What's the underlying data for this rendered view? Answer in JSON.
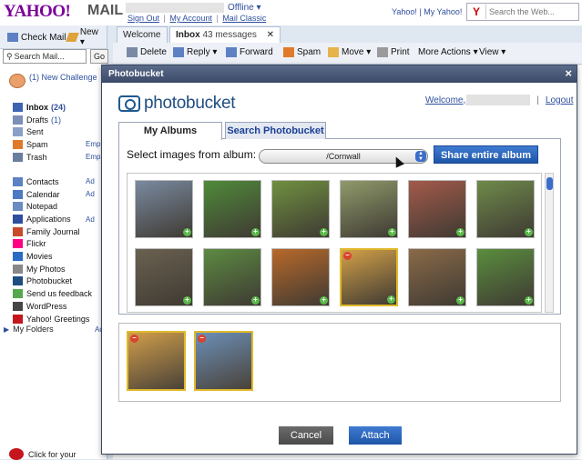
{
  "header": {
    "logo": "YAHOO!",
    "logo_product": "MAIL",
    "offline": "Offline ▾",
    "links": [
      "Sign Out",
      "My Account",
      "Mail Classic"
    ],
    "yahoo_links": "Yahoo! | My Yahoo!",
    "search_placeholder": "Search the Web..."
  },
  "sidebar": {
    "check_mail": "Check Mail",
    "new": "New ▾",
    "search_mail": "Search Mail...",
    "go": "Go",
    "challenge": "(1) New Challenge",
    "folders": [
      {
        "label": "Inbox",
        "count": "(24)",
        "bold": true,
        "icon": "inbox-icon",
        "color": "#3e64b1"
      },
      {
        "label": "Drafts",
        "count": "(1)",
        "bold": false,
        "icon": "drafts-icon",
        "color": "#7b8fb8"
      },
      {
        "label": "Sent",
        "count": "",
        "bold": false,
        "icon": "sent-icon",
        "color": "#8aa0c8"
      },
      {
        "label": "Spam",
        "count": "",
        "side": "Emp",
        "bold": false,
        "icon": "spam-icon",
        "color": "#e07a2a"
      },
      {
        "label": "Trash",
        "count": "",
        "side": "Emp",
        "bold": false,
        "icon": "trash-icon",
        "color": "#6a7e9e"
      },
      {
        "label": "",
        "count": "",
        "bold": false,
        "icon": "",
        "color": ""
      },
      {
        "label": "Contacts",
        "count": "",
        "side": "Ad",
        "bold": false,
        "icon": "contacts-icon",
        "color": "#5d81c2"
      },
      {
        "label": "Calendar",
        "count": "",
        "side": "Ad",
        "bold": false,
        "icon": "calendar-icon",
        "color": "#4c78c4"
      },
      {
        "label": "Notepad",
        "count": "",
        "bold": false,
        "icon": "notepad-icon",
        "color": "#6c8bc0"
      },
      {
        "label": "Applications",
        "count": "",
        "side": "Ad",
        "bold": false,
        "icon": "applications-icon",
        "color": "#2e4f9e"
      },
      {
        "label": "Family Journal",
        "count": "",
        "bold": false,
        "icon": "family-journal-icon",
        "color": "#c84a2b"
      },
      {
        "label": "Flickr",
        "count": "",
        "bold": false,
        "icon": "flickr-icon",
        "color": "#ff0084"
      },
      {
        "label": "Movies",
        "count": "",
        "bold": false,
        "icon": "movies-icon",
        "color": "#2a6cc4"
      },
      {
        "label": "My Photos",
        "count": "",
        "bold": false,
        "icon": "my-photos-icon",
        "color": "#888888"
      },
      {
        "label": "Photobucket",
        "count": "",
        "bold": false,
        "icon": "photobucket-icon",
        "color": "#1e4d80"
      },
      {
        "label": "Send us feedback",
        "count": "",
        "bold": false,
        "icon": "feedback-icon",
        "color": "#55a84c"
      },
      {
        "label": "WordPress",
        "count": "",
        "bold": false,
        "icon": "wordpress-icon",
        "color": "#464646"
      },
      {
        "label": "Yahoo! Greetings",
        "count": "",
        "bold": false,
        "icon": "greetings-icon",
        "color": "#c4161c"
      }
    ],
    "my_folders": "My Folders",
    "my_folders_side": "Ad",
    "click_for_your": "Click for your"
  },
  "tabs": {
    "welcome": "Welcome",
    "inbox": "Inbox",
    "inbox_count": "43 messages"
  },
  "toolbar": {
    "delete": "Delete",
    "reply": "Reply ▾",
    "forward": "Forward",
    "spam": "Spam",
    "move": "Move ▾",
    "print": "Print",
    "more_actions": "More Actions ▾",
    "view": "View ▾"
  },
  "modal": {
    "title": "Photobucket",
    "close": "×",
    "logo_text": "photobucket",
    "welcome": "Welcome,",
    "logout": "Logout",
    "tab_albums": "My Albums",
    "tab_search": "Search Photobucket",
    "select_label": "Select images from album:",
    "album_value": "/Cornwall",
    "share_button": "Share entire album",
    "cancel": "Cancel",
    "attach": "Attach"
  },
  "thumbnails": [
    {
      "color": "#7a8aa0",
      "selected": false
    },
    {
      "color": "#4f8a3a",
      "selected": false
    },
    {
      "color": "#6f9040",
      "selected": false
    },
    {
      "color": "#8f9a6a",
      "selected": false
    },
    {
      "color": "#a35a4a",
      "selected": false
    },
    {
      "color": "#6e8a4a",
      "selected": false
    },
    {
      "color": "#6a6150",
      "selected": false
    },
    {
      "color": "#5c8a42",
      "selected": false
    },
    {
      "color": "#b8692a",
      "selected": false
    },
    {
      "color": "#d2a048",
      "selected": true
    },
    {
      "color": "#8a6a48",
      "selected": false
    },
    {
      "color": "#5a8d3e",
      "selected": false
    },
    {
      "color": "#6f7a5a",
      "selected": false
    }
  ],
  "tray": [
    {
      "color": "#cf9d4a"
    },
    {
      "color": "#6b8fb8"
    }
  ],
  "colors": {
    "accent": "#1e55a8",
    "selected_border": "#e0b92c",
    "title_bar": "#3b4a69"
  }
}
